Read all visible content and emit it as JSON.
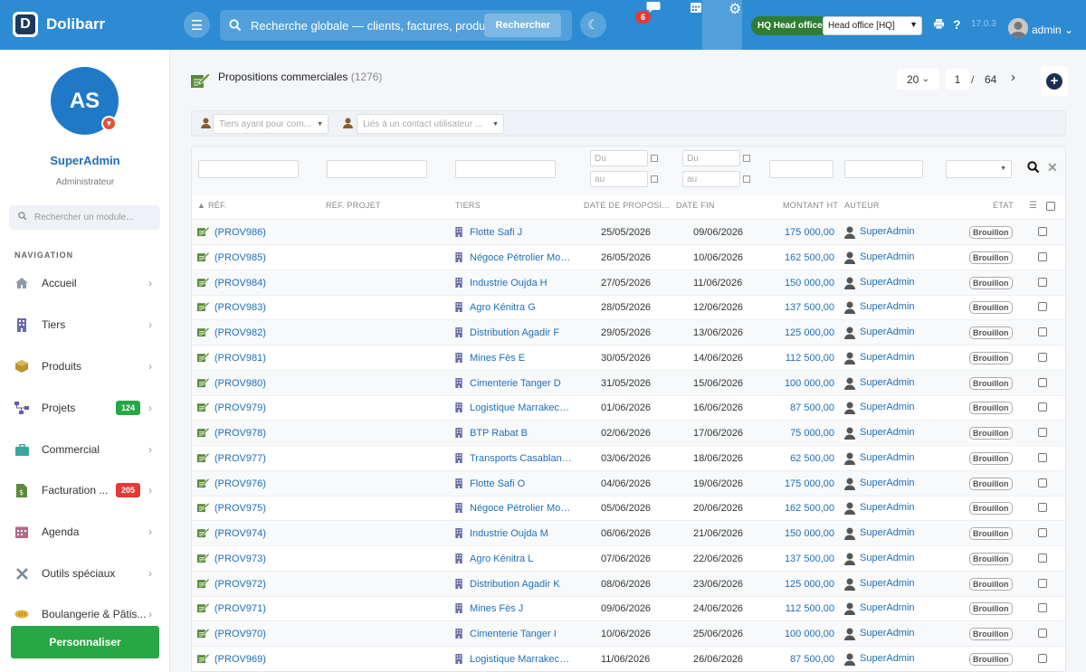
{
  "topbar": {
    "brand": "Dolibarr",
    "search_placeholder": "Recherche globale — clients, factures, produits...",
    "search_button": "Rechercher",
    "chat_badge": "6",
    "entity_badge": "HQ Head office",
    "entity_select": "Head office [HQ]",
    "version": "17.0.3",
    "user": "admin"
  },
  "sidebar": {
    "avatar_initials": "AS",
    "user_name": "SuperAdmin",
    "user_role": "Administrateur",
    "search_placeholder": "Rechercher un module...",
    "nav_title": "NAVIGATION",
    "items": [
      {
        "label": "Accueil",
        "icon": "home-icon"
      },
      {
        "label": "Tiers",
        "icon": "building-icon"
      },
      {
        "label": "Produits",
        "icon": "cube-icon"
      },
      {
        "label": "Projets",
        "icon": "sitemap-icon",
        "badge": "124",
        "badge_color": "#28a745"
      },
      {
        "label": "Commercial",
        "icon": "briefcase-icon"
      },
      {
        "label": "Facturation ...",
        "icon": "invoice-icon",
        "badge": "205",
        "badge_color": "#e53935"
      },
      {
        "label": "Agenda",
        "icon": "calendar-icon"
      },
      {
        "label": "Outils spéciaux",
        "icon": "tools-icon"
      },
      {
        "label": "Boulangerie & Pâtis...",
        "icon": "bread-icon"
      }
    ],
    "customize_button": "Personnaliser"
  },
  "page": {
    "title": "Propositions commerciales",
    "count": "(1276)",
    "per_page": "20",
    "current_page": "1",
    "page_sep": "/",
    "total_pages": "64"
  },
  "filters": {
    "tiers_placeholder": "Tiers ayant pour com...",
    "contact_placeholder": "Liés à un contact utilisateur ...",
    "date_from": "Du",
    "date_to": "au"
  },
  "columns": {
    "ref": "RÉF.",
    "ref_project": "RÉF. PROJET",
    "tiers": "TIERS",
    "date_prop": "DATE DE PROPOSI...",
    "date_end": "DATE FIN",
    "amount": "MONTANT HT",
    "author": "AUTEUR",
    "status": "ÉTAT"
  },
  "rows": [
    {
      "ref": "(PROV986)",
      "tiers": "Flotte Safi J",
      "date_prop": "25/05/2026",
      "date_end": "09/06/2026",
      "amount": "175 000,00",
      "author": "SuperAdmin",
      "status": "Brouillon"
    },
    {
      "ref": "(PROV985)",
      "tiers": "Négoce Pétrolier Moh...",
      "date_prop": "26/05/2026",
      "date_end": "10/06/2026",
      "amount": "162 500,00",
      "author": "SuperAdmin",
      "status": "Brouillon"
    },
    {
      "ref": "(PROV984)",
      "tiers": "Industrie Oujda H",
      "date_prop": "27/05/2026",
      "date_end": "11/06/2026",
      "amount": "150 000,00",
      "author": "SuperAdmin",
      "status": "Brouillon"
    },
    {
      "ref": "(PROV983)",
      "tiers": "Agro Kénitra G",
      "date_prop": "28/05/2026",
      "date_end": "12/06/2026",
      "amount": "137 500,00",
      "author": "SuperAdmin",
      "status": "Brouillon"
    },
    {
      "ref": "(PROV982)",
      "tiers": "Distribution Agadir F",
      "date_prop": "29/05/2026",
      "date_end": "13/06/2026",
      "amount": "125 000,00",
      "author": "SuperAdmin",
      "status": "Brouillon"
    },
    {
      "ref": "(PROV981)",
      "tiers": "Mines Fès E",
      "date_prop": "30/05/2026",
      "date_end": "14/06/2026",
      "amount": "112 500,00",
      "author": "SuperAdmin",
      "status": "Brouillon"
    },
    {
      "ref": "(PROV980)",
      "tiers": "Cimenterie Tanger D",
      "date_prop": "31/05/2026",
      "date_end": "15/06/2026",
      "amount": "100 000,00",
      "author": "SuperAdmin",
      "status": "Brouillon"
    },
    {
      "ref": "(PROV979)",
      "tiers": "Logistique Marrakech C",
      "date_prop": "01/06/2026",
      "date_end": "16/06/2026",
      "amount": "87 500,00",
      "author": "SuperAdmin",
      "status": "Brouillon"
    },
    {
      "ref": "(PROV978)",
      "tiers": "BTP Rabat B",
      "date_prop": "02/06/2026",
      "date_end": "17/06/2026",
      "amount": "75 000,00",
      "author": "SuperAdmin",
      "status": "Brouillon"
    },
    {
      "ref": "(PROV977)",
      "tiers": "Transports Casablanc...",
      "date_prop": "03/06/2026",
      "date_end": "18/06/2026",
      "amount": "62 500,00",
      "author": "SuperAdmin",
      "status": "Brouillon"
    },
    {
      "ref": "(PROV976)",
      "tiers": "Flotte Safi O",
      "date_prop": "04/06/2026",
      "date_end": "19/06/2026",
      "amount": "175 000,00",
      "author": "SuperAdmin",
      "status": "Brouillon"
    },
    {
      "ref": "(PROV975)",
      "tiers": "Négoce Pétrolier Moh...",
      "date_prop": "05/06/2026",
      "date_end": "20/06/2026",
      "amount": "162 500,00",
      "author": "SuperAdmin",
      "status": "Brouillon"
    },
    {
      "ref": "(PROV974)",
      "tiers": "Industrie Oujda M",
      "date_prop": "06/06/2026",
      "date_end": "21/06/2026",
      "amount": "150 000,00",
      "author": "SuperAdmin",
      "status": "Brouillon"
    },
    {
      "ref": "(PROV973)",
      "tiers": "Agro Kénitra L",
      "date_prop": "07/06/2026",
      "date_end": "22/06/2026",
      "amount": "137 500,00",
      "author": "SuperAdmin",
      "status": "Brouillon"
    },
    {
      "ref": "(PROV972)",
      "tiers": "Distribution Agadir K",
      "date_prop": "08/06/2026",
      "date_end": "23/06/2026",
      "amount": "125 000,00",
      "author": "SuperAdmin",
      "status": "Brouillon"
    },
    {
      "ref": "(PROV971)",
      "tiers": "Mines Fès J",
      "date_prop": "09/06/2026",
      "date_end": "24/06/2026",
      "amount": "112 500,00",
      "author": "SuperAdmin",
      "status": "Brouillon"
    },
    {
      "ref": "(PROV970)",
      "tiers": "Cimenterie Tanger I",
      "date_prop": "10/06/2026",
      "date_end": "25/06/2026",
      "amount": "100 000,00",
      "author": "SuperAdmin",
      "status": "Brouillon"
    },
    {
      "ref": "(PROV969)",
      "tiers": "Logistique Marrakech H",
      "date_prop": "11/06/2026",
      "date_end": "26/06/2026",
      "amount": "87 500,00",
      "author": "SuperAdmin",
      "status": "Brouillon"
    }
  ]
}
